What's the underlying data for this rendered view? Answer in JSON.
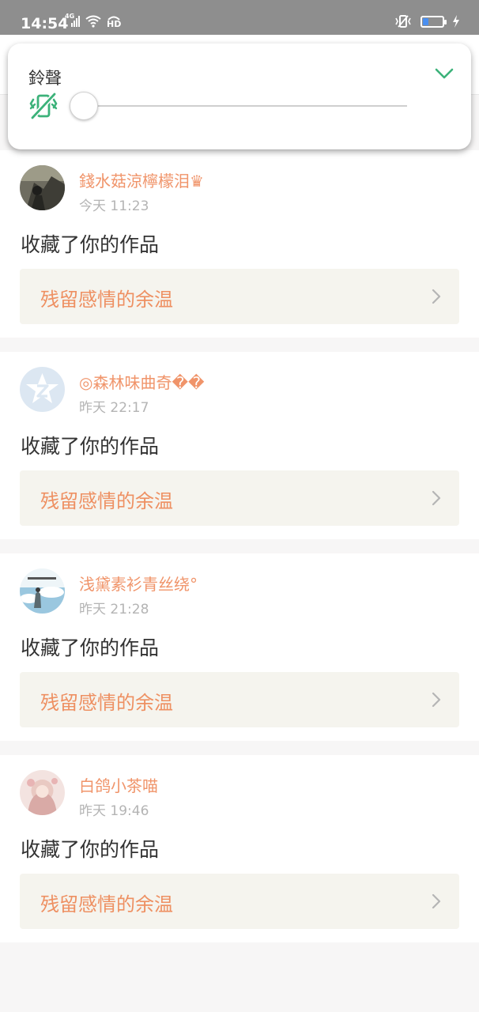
{
  "status_bar": {
    "time": "14:54",
    "network": "4G",
    "hd": "HD",
    "battery_level": 0.3,
    "icons": [
      "signal-icon",
      "wifi-icon",
      "hd-icon",
      "vibrate-icon",
      "battery-icon",
      "charging-icon"
    ]
  },
  "volume_panel": {
    "title": "鈴聲",
    "level": 0,
    "icons": [
      "mute-vibrate-icon",
      "chevron-down-icon"
    ],
    "accent_color": "#3cb27a"
  },
  "notifications": [
    {
      "user": "錢水菇涼檸檬泪♛",
      "time": "今天 11:23",
      "action": "收藏了你的作品",
      "work_title": "残留感情的余温",
      "avatar_colors": [
        "#4a4a42",
        "#8b8a7a"
      ]
    },
    {
      "user": "◎森林味曲奇��",
      "time": "昨天 22:17",
      "action": "收藏了你的作品",
      "work_title": "残留感情的余温",
      "avatar_colors": [
        "#dbe7f3",
        "#ffffff"
      ]
    },
    {
      "user": "浅黛素衫青丝绕°",
      "time": "昨天 21:28",
      "action": "收藏了你的作品",
      "work_title": "残留感情的余温",
      "avatar_colors": [
        "#9ac7df",
        "#eef5f8"
      ]
    },
    {
      "user": "白鸽小茶喵",
      "time": "昨天 19:46",
      "action": "收藏了你的作品",
      "work_title": "残留感情的余温",
      "avatar_colors": [
        "#e8cfc9",
        "#f5e8e6"
      ]
    }
  ],
  "colors": {
    "username": "#f0946a",
    "work_title": "#ee9062",
    "work_bg": "#f5f4ee",
    "timestamp": "#b4b4b4"
  }
}
